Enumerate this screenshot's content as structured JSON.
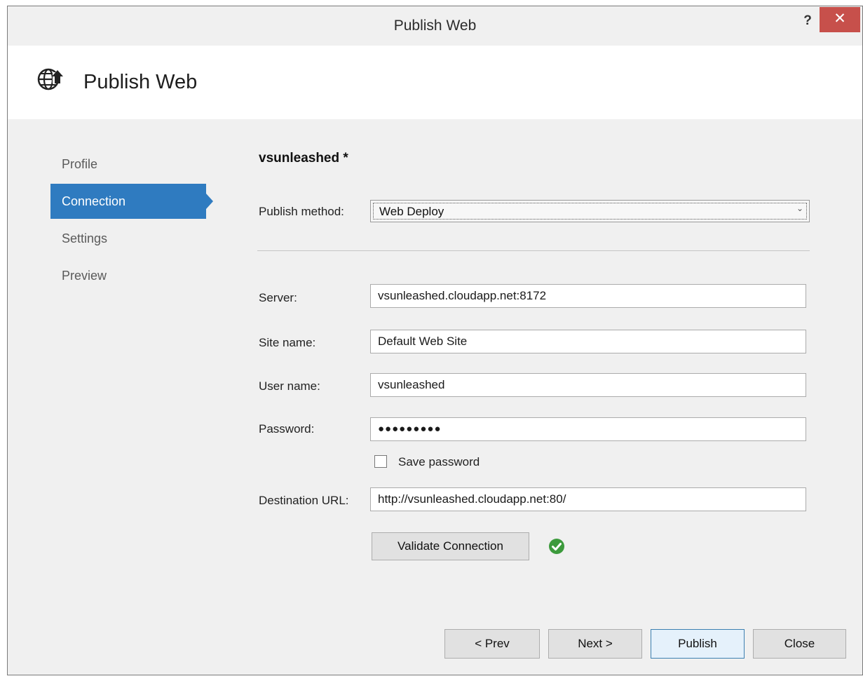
{
  "window": {
    "title": "Publish Web",
    "help_label": "?",
    "close_label": "✕"
  },
  "header": {
    "title": "Publish Web",
    "icon": "globe-publish-icon"
  },
  "nav": {
    "items": [
      {
        "label": "Profile",
        "active": false
      },
      {
        "label": "Connection",
        "active": true
      },
      {
        "label": "Settings",
        "active": false
      },
      {
        "label": "Preview",
        "active": false
      }
    ]
  },
  "main": {
    "profile_name": "vsunleashed *",
    "publish_method": {
      "label": "Publish method:",
      "value": "Web Deploy"
    },
    "server": {
      "label": "Server:",
      "value": "vsunleashed.cloudapp.net:8172"
    },
    "site_name": {
      "label": "Site name:",
      "value": "Default Web Site"
    },
    "user_name": {
      "label": "User name:",
      "value": "vsunleashed"
    },
    "password": {
      "label": "Password:",
      "value": "●●●●●●●●●"
    },
    "save_password": {
      "label": "Save password",
      "checked": false
    },
    "destination_url": {
      "label": "Destination URL:",
      "value": "http://vsunleashed.cloudapp.net:80/"
    },
    "validate_label": "Validate Connection",
    "validation_status": "success"
  },
  "footer": {
    "prev_label": "< Prev",
    "next_label": "Next >",
    "publish_label": "Publish",
    "close_label": "Close"
  },
  "colors": {
    "accent": "#2f7bc0",
    "close_button": "#c7504b",
    "success": "#3c9a3c"
  }
}
